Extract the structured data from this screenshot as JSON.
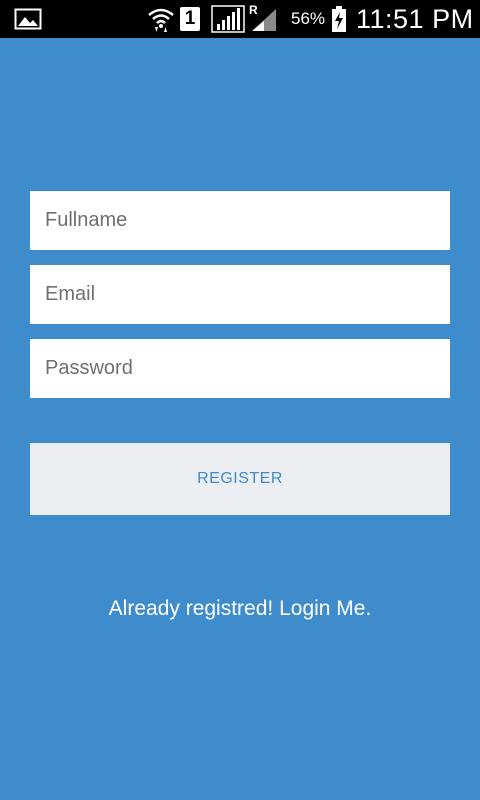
{
  "status_bar": {
    "sim_slot": "1",
    "roaming_indicator": "R",
    "battery_percent": "56%",
    "time": "11:51 PM",
    "icons": [
      "gallery-icon",
      "wifi-icon",
      "signal-icon",
      "roaming-signal-icon",
      "battery-charging-icon"
    ]
  },
  "form": {
    "fullname": {
      "placeholder": "Fullname",
      "value": ""
    },
    "email": {
      "placeholder": "Email",
      "value": ""
    },
    "password": {
      "placeholder": "Password",
      "value": ""
    },
    "register_label": "REGISTER"
  },
  "footer": {
    "login_link": "Already registred! Login Me."
  },
  "colors": {
    "background": "#3f8ccc",
    "status_bar": "#000000",
    "field_background": "#ffffff",
    "button_background": "#eceef1",
    "button_text": "#3f8ccc",
    "link_text": "#ffffff"
  }
}
